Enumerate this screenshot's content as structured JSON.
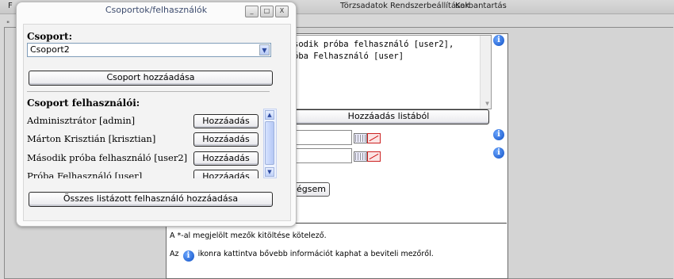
{
  "menubar": {
    "first_letter": "F",
    "items": [
      "Törzsadatok",
      "Rendszerbeállítások",
      "Karbantartás"
    ]
  },
  "background_form": {
    "section_corner": "\"",
    "list_lines": [
      "sodik próba felhasználó [user2],",
      "óba Felhasználó [user]"
    ],
    "add_from_list_label": "Hozzáadás listából",
    "cancel_label": "égsem",
    "required_note": "A *-al megjelölt mezők kitöltése kötelező.",
    "info_note_prefix": "Az",
    "info_note_suffix": "ikonra kattintva bővebb információt kaphat a beviteli mezőről.",
    "info_icon": "info-icon",
    "date_icons": [
      "calendar-icon",
      "clear-date-icon"
    ]
  },
  "dialog": {
    "title": "Csoportok/felhasználók",
    "window_buttons": [
      "_",
      "□",
      "X"
    ],
    "group_label": "Csoport:",
    "group_select_value": "Csoport2",
    "add_group_label": "Csoport hozzáadása",
    "group_users_label": "Csoport felhasználói:",
    "users": [
      {
        "name": "Adminisztrátor [admin]",
        "button": "Hozzáadás"
      },
      {
        "name": "Márton Krisztián [krisztian]",
        "button": "Hozzáadás"
      },
      {
        "name": "Második próba felhasználó [user2]",
        "button": "Hozzáadás"
      },
      {
        "name": "Próba Felhasználó [user]",
        "button": "Hozzáadás"
      }
    ],
    "add_all_label": "Összes listázott felhasználó hozzáadása"
  }
}
